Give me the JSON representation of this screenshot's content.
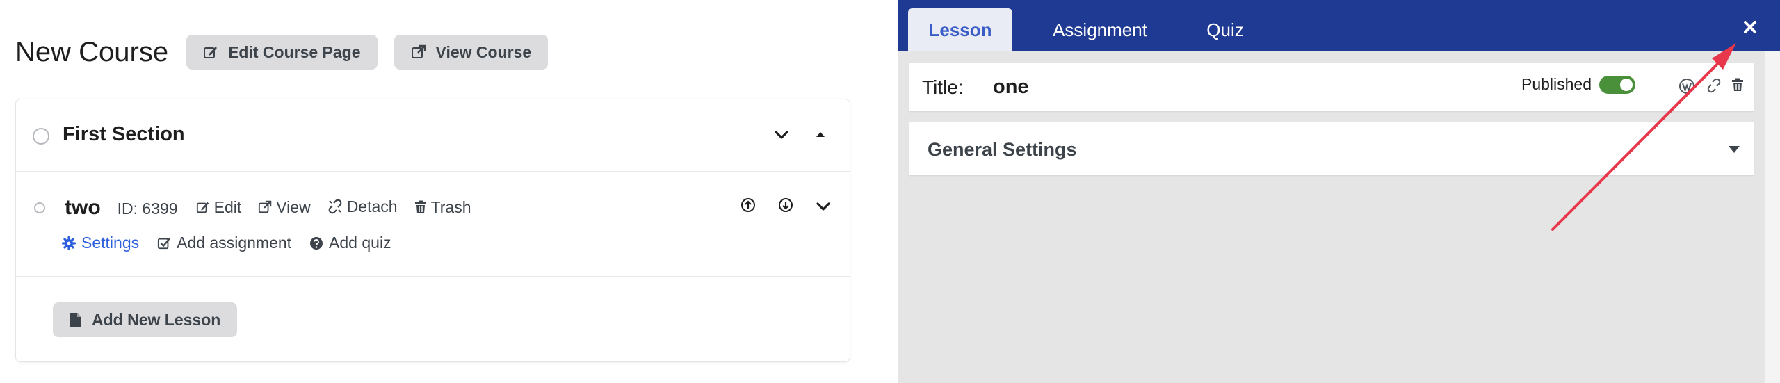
{
  "course": {
    "title": "New Course",
    "edit_page_label": "Edit Course Page",
    "view_course_label": "View Course"
  },
  "section": {
    "title": "First Section",
    "lesson": {
      "name": "two",
      "id_text": "ID: 6399",
      "edit_label": "Edit",
      "view_label": "View",
      "detach_label": "Detach",
      "trash_label": "Trash",
      "settings_label": "Settings",
      "add_assignment_label": "Add assignment",
      "add_quiz_label": "Add quiz"
    },
    "add_lesson_label": "Add New Lesson"
  },
  "editor": {
    "tabs": [
      {
        "label": "Lesson",
        "active": true
      },
      {
        "label": "Assignment",
        "active": false
      },
      {
        "label": "Quiz",
        "active": false
      }
    ],
    "title_label": "Title:",
    "title_value": "one",
    "published_label": "Published",
    "published": true,
    "settings_header": "General Settings"
  },
  "colors": {
    "topbar": "#1f3a93",
    "accent_link": "#2c5ede",
    "toggle_on": "#4a8f3a",
    "annotation_arrow": "#e8374a"
  }
}
